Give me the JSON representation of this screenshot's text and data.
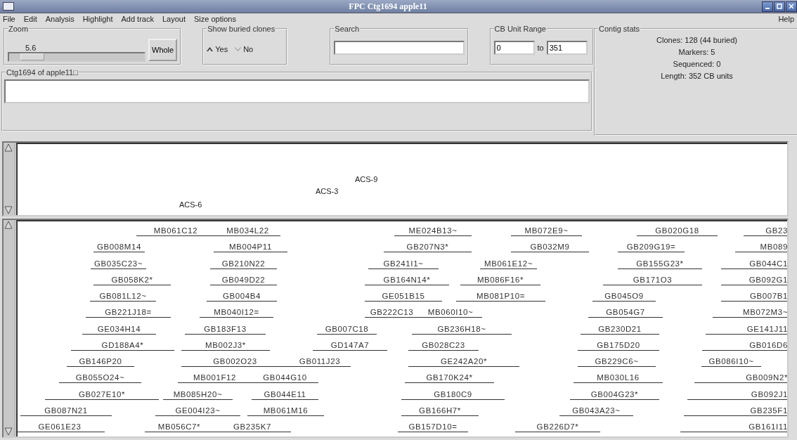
{
  "window": {
    "title": "FPC Ctg1694 apple11"
  },
  "menu": [
    "File",
    "Edit",
    "Analysis",
    "Highlight",
    "Add track",
    "Layout",
    "Size options"
  ],
  "help": "Help",
  "zoom": {
    "label": "Zoom",
    "value": "5.6",
    "level": 0.1,
    "button": "Whole"
  },
  "buried": {
    "label": "Show buried clones",
    "options": [
      {
        "label": "Yes",
        "selected": true
      },
      {
        "label": "No",
        "selected": false
      }
    ]
  },
  "search": {
    "label": "Search"
  },
  "cb_range": {
    "label": "CB Unit Range",
    "from": "0",
    "to_label": "to",
    "to": "351"
  },
  "contig_stats": {
    "label": "Contig stats",
    "lines": [
      "Clones: 128 (44 buried)",
      "Markers: 5",
      "Sequenced: 0",
      "Length: 352 CB units"
    ]
  },
  "remark": {
    "label": "Ctg1694 of apple11□"
  },
  "markers": [
    "ACS-9",
    "ACS-3",
    "ACS-6"
  ],
  "clone_rows": [
    [
      "MB061C12",
      "MB034L22",
      "ME024B13~",
      "MB072E9~",
      "GB020G18",
      "GB23"
    ],
    [
      "GB008M14",
      "MB004P11",
      "GB207N3*",
      "GB032M9",
      "GB209G19=",
      "MB089"
    ],
    [
      "GB035C23~",
      "GB210N22",
      "GB241I1~",
      "MB061E12~",
      "GB155G23*",
      "GB044C1"
    ],
    [
      "GB058K2*",
      "GB049D22",
      "GB164N14*",
      "MB086F16*",
      "GB171O3",
      "GB092G1"
    ],
    [
      "GB081L12~",
      "GB004B4",
      "GE051B15",
      "MB081P10=",
      "GB045O9",
      "GB007B1"
    ],
    [
      "GB221J18=",
      "MB040I12=",
      "GB222C13",
      "MB060I10~",
      "GB054G7",
      "MB072M3~"
    ],
    [
      "GE034H14",
      "GB183F13",
      "GB007C18",
      "GB236H18~",
      "GB230D21",
      "GE141J11"
    ],
    [
      "GD188A4*",
      "MB002J3*",
      "GD147A7",
      "GB028C23",
      "GB175D20",
      "GB016D6"
    ],
    [
      "GB146P20",
      "GB002O23",
      "GB011J23",
      "GE242A20*",
      "GB229C6~",
      "GB086I10~"
    ],
    [
      "GB055O24~",
      "MB001F12",
      "GB044G10",
      "GB170K24*",
      "MB030L16",
      "GB009N2*"
    ],
    [
      "GB027E10*",
      "MB085H20~",
      "GB044E11",
      "GB180C9",
      "GB004G23*",
      "GB092J1"
    ],
    [
      "GB087N21",
      "GE004I23~",
      "MB061M16",
      "GB166H7*",
      "GB043A23~",
      "GB235F1"
    ],
    [
      "GE061E23",
      "MB056C7*",
      "GB235K7",
      "GB157D10=",
      "GB226D7*",
      "GB161I11"
    ]
  ]
}
